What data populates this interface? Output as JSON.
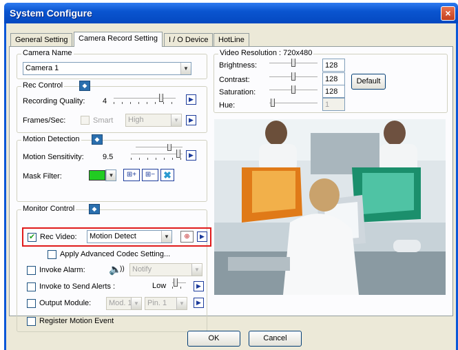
{
  "window": {
    "title": "System Configure",
    "close_label": "×"
  },
  "tabs": [
    {
      "label": "General Setting",
      "active": false
    },
    {
      "label": "Camera Record Setting",
      "active": true
    },
    {
      "label": "I / O Device",
      "active": false
    },
    {
      "label": "HotLine",
      "active": false
    }
  ],
  "camera_name": {
    "title": "Camera Name",
    "value": "Camera 1"
  },
  "rec_control": {
    "title": "Rec Control",
    "quality_label": "Recording Quality:",
    "quality_value": "4",
    "frames_label": "Frames/Sec:",
    "smart_label": "Smart",
    "smart_checked": false,
    "frames_value": "High"
  },
  "motion_detection": {
    "title": "Motion Detection",
    "sensitivity_label": "Motion Sensitivity:",
    "sensitivity_value": "9.5",
    "mask_label": "Mask Filter:",
    "mask_color": "#22cc22"
  },
  "monitor_control": {
    "title": "Monitor Control",
    "rec_video_label": "Rec Video:",
    "rec_video_checked": true,
    "rec_video_value": "Motion Detect",
    "advanced_codec_label": "Apply Advanced Codec Setting...",
    "invoke_alarm_label": "Invoke Alarm:",
    "alarm_value": "Notify",
    "invoke_alerts_label": "Invoke to Send Alerts :",
    "alerts_level": "Low",
    "output_module_label": "Output Module:",
    "module_value": "Mod. 1",
    "pin_value": "Pin. 1",
    "register_motion_label": "Register Motion Event"
  },
  "video_resolution": {
    "title": "Video Resolution : 720x480",
    "brightness_label": "Brightness:",
    "brightness_value": "128",
    "contrast_label": "Contrast:",
    "contrast_value": "128",
    "saturation_label": "Saturation:",
    "saturation_value": "128",
    "hue_label": "Hue:",
    "hue_value": "1",
    "default_label": "Default"
  },
  "footer": {
    "ok_label": "OK",
    "cancel_label": "Cancel"
  },
  "colors": {
    "title_bar": "#0a55d0",
    "highlight": "#e01a1a",
    "dialog_bg": "#ece9d8"
  }
}
